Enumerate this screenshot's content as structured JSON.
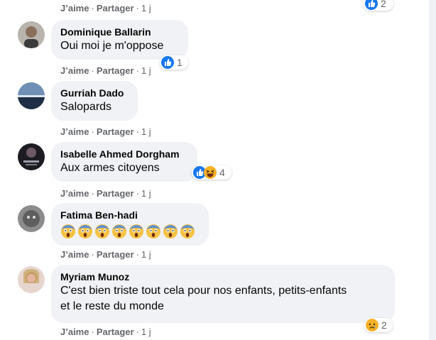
{
  "actions": {
    "like": "J’aime",
    "share": "Partager",
    "sep": "·",
    "time": "1 j"
  },
  "top_reaction_count": "2",
  "comments": [
    {
      "author": "Dominique Ballarin",
      "text": "Oui moi je m'oppose",
      "reaction_count": "1",
      "reactions": [
        "like-icon"
      ]
    },
    {
      "author": "Gurriah Dado",
      "text": "Salopards"
    },
    {
      "author": "Isabelle Ahmed Dorgham",
      "text": "Aux armes citoyens",
      "reaction_count": "4",
      "reactions": [
        "like-icon",
        "haha-icon"
      ]
    },
    {
      "author": "Fatima Ben-hadi",
      "emojis": [
        "fear-emoji",
        "fear-emoji",
        "fear-emoji",
        "fear-emoji",
        "fear-emoji",
        "fear-emoji",
        "fear-emoji",
        "fear-emoji"
      ]
    },
    {
      "author": "Myriam Munoz",
      "text_line1": "C'est bien triste tout cela pour nos enfants, petits-enfants",
      "text_line2": "et le reste du monde",
      "reaction_count": "2",
      "reactions": [
        "sad-icon"
      ]
    }
  ],
  "colors": {
    "bubble": "#f0f2f5",
    "meta": "#65676b",
    "like_blue": "#1877f2",
    "haha_yellow": "#f7b125"
  }
}
